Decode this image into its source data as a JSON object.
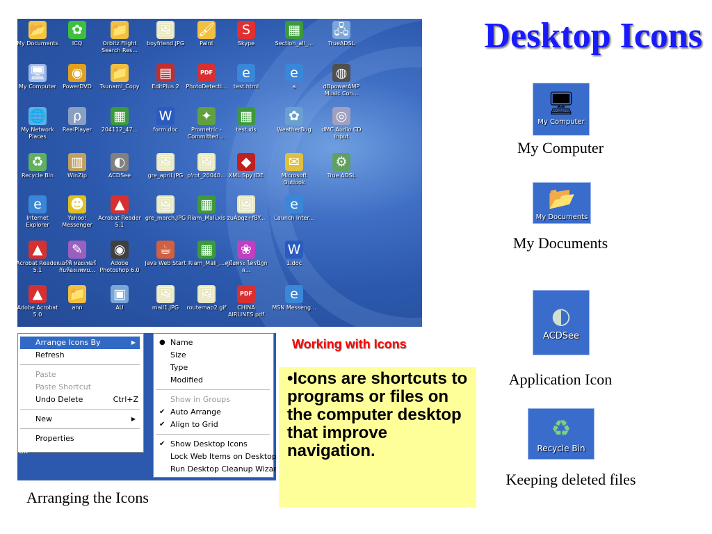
{
  "title": "Desktop Icons",
  "desktop_icons": [
    {
      "label": "My Documents",
      "glyph": "📂",
      "color": "#f4c542"
    },
    {
      "label": "ICQ",
      "glyph": "✿",
      "color": "#3fbf3f"
    },
    {
      "label": "Orbitz Flight Search Res...",
      "glyph": "📁",
      "color": "#f0c040"
    },
    {
      "label": "boyfriend.JPG",
      "glyph": "🖼",
      "color": "#e7e7c0"
    },
    {
      "label": "Paint",
      "glyph": "🖌",
      "color": "#f0c040"
    },
    {
      "label": "Skype",
      "glyph": "S",
      "color": "#e03030"
    },
    {
      "label": "Section_all_...",
      "glyph": "▦",
      "color": "#3c9a3c"
    },
    {
      "label": "TrueADSL",
      "glyph": "🖧",
      "color": "#7aa6d8"
    },
    {
      "label": "My Computer",
      "glyph": "🖥",
      "color": "#9ab8e8"
    },
    {
      "label": "PowerDVD",
      "glyph": "◉",
      "color": "#e0a020"
    },
    {
      "label": "Tsunami_Copy",
      "glyph": "📁",
      "color": "#f0c040"
    },
    {
      "label": "EditPlus 2",
      "glyph": "▤",
      "color": "#c03030"
    },
    {
      "label": "PhotoDetecti...",
      "glyph": "PDF",
      "color": "#d83030"
    },
    {
      "label": "test.html",
      "glyph": "e",
      "color": "#3a86d8"
    },
    {
      "label": "a",
      "glyph": "e",
      "color": "#3a86d8"
    },
    {
      "label": "dBpowerAMP Music Con...",
      "glyph": "◍",
      "color": "#505050"
    },
    {
      "label": "My Network Places",
      "glyph": "🌐",
      "color": "#5ab0e0"
    },
    {
      "label": "RealPlayer",
      "glyph": "ρ",
      "color": "#8aa0c0"
    },
    {
      "label": "204112_47...",
      "glyph": "▦",
      "color": "#3c9a3c"
    },
    {
      "label": "form.doc",
      "glyph": "W",
      "color": "#2b5bbf"
    },
    {
      "label": "Prometric - Committed ...",
      "glyph": "✦",
      "color": "#60a040"
    },
    {
      "label": "test.xls",
      "glyph": "▦",
      "color": "#3c9a3c"
    },
    {
      "label": "WeatherBug",
      "glyph": "✿",
      "color": "#6aa0d0"
    },
    {
      "label": "dMC Audio CD Input",
      "glyph": "◎",
      "color": "#a0a0c0"
    },
    {
      "label": "Recycle Bin",
      "glyph": "♻",
      "color": "#60b060"
    },
    {
      "label": "WinZip",
      "glyph": "▥",
      "color": "#c0a060"
    },
    {
      "label": "ACDSee",
      "glyph": "◐",
      "color": "#808080"
    },
    {
      "label": "gre_april.JPG",
      "glyph": "🖼",
      "color": "#e7e7c0"
    },
    {
      "label": "p'rot_20040...",
      "glyph": "🖼",
      "color": "#e7e7c0"
    },
    {
      "label": "XML Spy IDE",
      "glyph": "◆",
      "color": "#c02020"
    },
    {
      "label": "Microsoft Outlook",
      "glyph": "✉",
      "color": "#e0c040"
    },
    {
      "label": "True ADSL",
      "glyph": "⚙",
      "color": "#60a060"
    },
    {
      "label": "Internet Explorer",
      "glyph": "e",
      "color": "#3a86d8"
    },
    {
      "label": "Yahoo! Messenger",
      "glyph": "☻",
      "color": "#e0c020"
    },
    {
      "label": "Acrobat Reader 5.1",
      "glyph": "▲",
      "color": "#d83030"
    },
    {
      "label": "gre_march.JPG",
      "glyph": "🖼",
      "color": "#e7e7c0"
    },
    {
      "label": "Riam_Mali.xls",
      "glyph": "▦",
      "color": "#3c9a3c"
    },
    {
      "label": "zuApqz+fBY...",
      "glyph": "🖼",
      "color": "#e7e7c0"
    },
    {
      "label": "Launch Inter...",
      "glyph": "e",
      "color": "#3a86d8"
    },
    {
      "label": "",
      "glyph": "",
      "color": ""
    },
    {
      "label": "Acrobat Reader 5.1",
      "glyph": "▲",
      "color": "#d83030"
    },
    {
      "label": "แอร์ฟี หอยเฟอร์ กับห้องแพทย...",
      "glyph": "✎",
      "color": "#9a60c0"
    },
    {
      "label": "Adobe Photoshop 6.0",
      "glyph": "◉",
      "color": "#404040"
    },
    {
      "label": "Java Web Start",
      "glyph": "☕",
      "color": "#d06040"
    },
    {
      "label": "Riam_Mali_...",
      "glyph": "▦",
      "color": "#3c9a3c"
    },
    {
      "label": "คู่มือพระ ไตรปิฎกล...",
      "glyph": "❀",
      "color": "#c040c0"
    },
    {
      "label": "1.doc",
      "glyph": "W",
      "color": "#2b5bbf"
    },
    {
      "label": "",
      "glyph": "",
      "color": ""
    },
    {
      "label": "Adobe Acrobat 5.0",
      "glyph": "▲",
      "color": "#d83030"
    },
    {
      "label": "ann",
      "glyph": "📁",
      "color": "#f0c040"
    },
    {
      "label": "AU",
      "glyph": "▣",
      "color": "#7aa6d8"
    },
    {
      "label": "mail1.JPG",
      "glyph": "🖼",
      "color": "#e7e7c0"
    },
    {
      "label": "routemap2.gif",
      "glyph": "🖼",
      "color": "#e7e7c0"
    },
    {
      "label": "CHINA AIRLINES.pdf",
      "glyph": "PDF",
      "color": "#d83030"
    },
    {
      "label": "MSN Messeng...",
      "glyph": "e",
      "color": "#3a86d8"
    }
  ],
  "samples": {
    "my_computer": {
      "tile_label": "My Computer",
      "caption": "My Computer",
      "glyph": "🖥"
    },
    "my_documents": {
      "tile_label": "My Documents",
      "caption": "My Documents",
      "glyph": "📂"
    },
    "acdsee": {
      "tile_label": "ACDSee",
      "caption": "Application Icon",
      "glyph": "◐"
    },
    "recycle_bin": {
      "tile_label": "Recycle Bin",
      "caption": "Keeping deleted files",
      "glyph": "♻"
    }
  },
  "context_menu": {
    "main": {
      "arrange": "Arrange Icons By",
      "refresh": "Refresh",
      "paste": "Paste",
      "paste_shortcut": "Paste Shortcut",
      "undo": "Undo Delete",
      "undo_key": "Ctrl+Z",
      "new": "New",
      "properties": "Properties"
    },
    "submenu": {
      "name": "Name",
      "size": "Size",
      "type": "Type",
      "modified": "Modified",
      "show_groups": "Show in Groups",
      "auto_arrange": "Auto Arrange",
      "align_grid": "Align to Grid",
      "show_desktop_icons": "Show Desktop Icons",
      "lock_web": "Lock Web Items on Desktop",
      "cleanup": "Run Desktop Cleanup Wizard"
    },
    "ok_text": "ok"
  },
  "arranging_caption": "Arranging the Icons",
  "working_heading": "Working with Icons",
  "note_text": "•Icons are shortcuts to programs or files on the computer desktop that improve navigation."
}
